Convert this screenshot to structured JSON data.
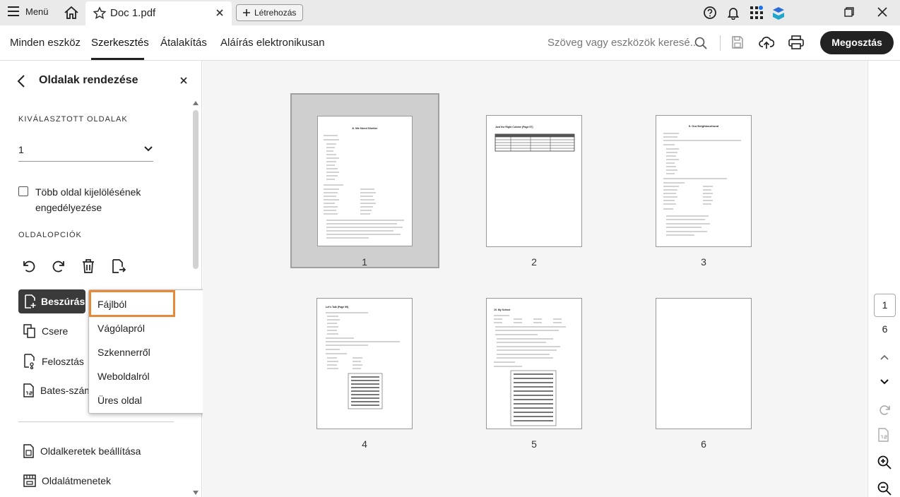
{
  "titlebar": {
    "menu_label": "Menü",
    "doc_name": "Doc 1.pdf",
    "new_label": "Létrehozás"
  },
  "menubar": {
    "tabs": [
      "Minden eszköz",
      "Szerkesztés",
      "Átalakítás",
      "Aláírás elektronikusan"
    ],
    "active_tab": "Szerkesztés",
    "search_placeholder": "Szöveg vagy eszközök keresé...",
    "share_label": "Megosztás"
  },
  "sidebar": {
    "title": "Oldalak rendezése",
    "selected_pages_label": "KIVÁLASZTOTT OLDALAK",
    "selected_value": "1",
    "multi_select_label": "Több oldal kijelölésének engedélyezése",
    "page_options_label": "OLDALOPCIÓK",
    "insert_label": "Beszúrás",
    "replace_label": "Csere",
    "split_label": "Felosztás",
    "bates_label": "Bates-szám",
    "page_boxes_label": "Oldalkeretek beállítása",
    "page_transitions_label": "Oldalátmenetek"
  },
  "insert_menu": [
    "Fájlból",
    "Vágólapról",
    "Szkennerről",
    "Weboldalról",
    "Üres oldal"
  ],
  "pages": [
    {
      "num": "1",
      "title": "8. We Need Shelter"
    },
    {
      "num": "2",
      "title": "Just the Right Cuisine (Page 97)"
    },
    {
      "num": "3",
      "title": "9. Our Neighbourhood"
    },
    {
      "num": "4",
      "title": "Let's Talk (Page 99)"
    },
    {
      "num": "5",
      "title": "10. My School"
    },
    {
      "num": "6",
      "title": ""
    }
  ],
  "rightbar": {
    "current_page": "1",
    "total_pages": "6"
  },
  "colors": {
    "highlight": "#e68a3a",
    "dark_button": "#222222",
    "selection_bg": "#cfcfcf"
  }
}
